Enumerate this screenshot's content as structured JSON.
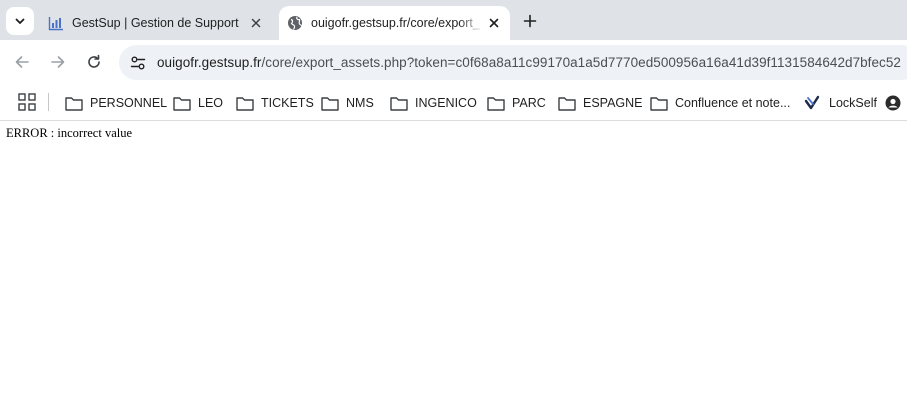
{
  "tabs": [
    {
      "title": "GestSup | Gestion de Support",
      "favicon": "bar-chart-icon",
      "active": false
    },
    {
      "title": "ouigofr.gestsup.fr/core/export_",
      "favicon": "globe-icon",
      "active": true
    }
  ],
  "toolbar": {
    "url_host": "ouigofr.gestsup.fr",
    "url_path": "/core/export_assets.php?token=c0f68a8a11c99170a1a5d7770ed500956a16a41d39f1131584642d7bfec52"
  },
  "bookmarks": [
    {
      "label": "PERSONNEL",
      "icon": "folder-icon"
    },
    {
      "label": "LEO",
      "icon": "folder-icon"
    },
    {
      "label": "TICKETS",
      "icon": "folder-icon"
    },
    {
      "label": "NMS",
      "icon": "folder-icon"
    },
    {
      "label": "INGENICO",
      "icon": "folder-icon"
    },
    {
      "label": "PARC",
      "icon": "folder-icon"
    },
    {
      "label": "ESPAGNE",
      "icon": "folder-icon"
    },
    {
      "label": "Confluence et note...",
      "icon": "folder-icon"
    },
    {
      "label": "LockSelf",
      "icon": "lockself-icon"
    }
  ],
  "page": {
    "error_message": "ERROR : incorrect value"
  },
  "colors": {
    "tabstrip_bg": "#dfe3e8",
    "omnibox_bg": "#eef1f5",
    "favicon_blue": "#4a73c8"
  }
}
